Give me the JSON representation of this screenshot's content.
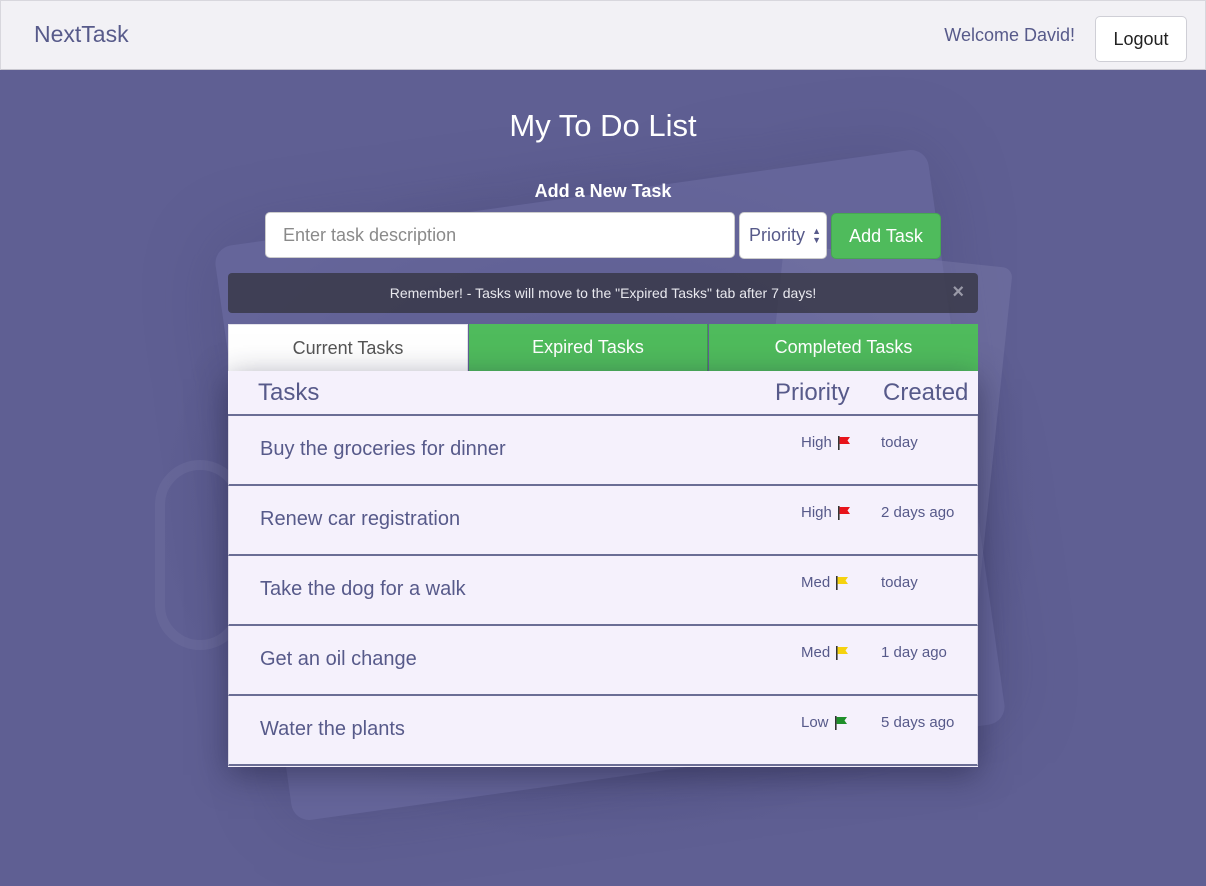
{
  "navbar": {
    "brand": "NextTask",
    "welcome": "Welcome David!",
    "logout_label": "Logout"
  },
  "main": {
    "title": "My To Do List",
    "add_title": "Add a New Task",
    "task_input_placeholder": "Enter task description",
    "priority_select_value": "Priority",
    "add_button_label": "Add Task",
    "alert_text": "Remember! - Tasks will move to the \"Expired Tasks\" tab after 7 days!",
    "alert_close": "×"
  },
  "tabs": [
    {
      "label": "Current Tasks",
      "active": true
    },
    {
      "label": "Expired Tasks",
      "active": false
    },
    {
      "label": "Completed Tasks",
      "active": false
    }
  ],
  "table": {
    "headers": {
      "tasks": "Tasks",
      "priority": "Priority",
      "created": "Created"
    },
    "rows": [
      {
        "description": "Buy the groceries for dinner",
        "priority": "High",
        "flag_color": "#e8141b",
        "created": "today"
      },
      {
        "description": "Renew car registration",
        "priority": "High",
        "flag_color": "#e8141b",
        "created": "2 days ago"
      },
      {
        "description": "Take the dog for a walk",
        "priority": "Med",
        "flag_color": "#f5d20f",
        "created": "today"
      },
      {
        "description": "Get an oil change",
        "priority": "Med",
        "flag_color": "#f5d20f",
        "created": "1 day ago"
      },
      {
        "description": "Water the plants",
        "priority": "Low",
        "flag_color": "#1f8f2a",
        "created": "5 days ago"
      }
    ]
  },
  "colors": {
    "background": "#5f5f93",
    "accent_green": "#4fbb5c",
    "text_purple": "#575a8a"
  }
}
